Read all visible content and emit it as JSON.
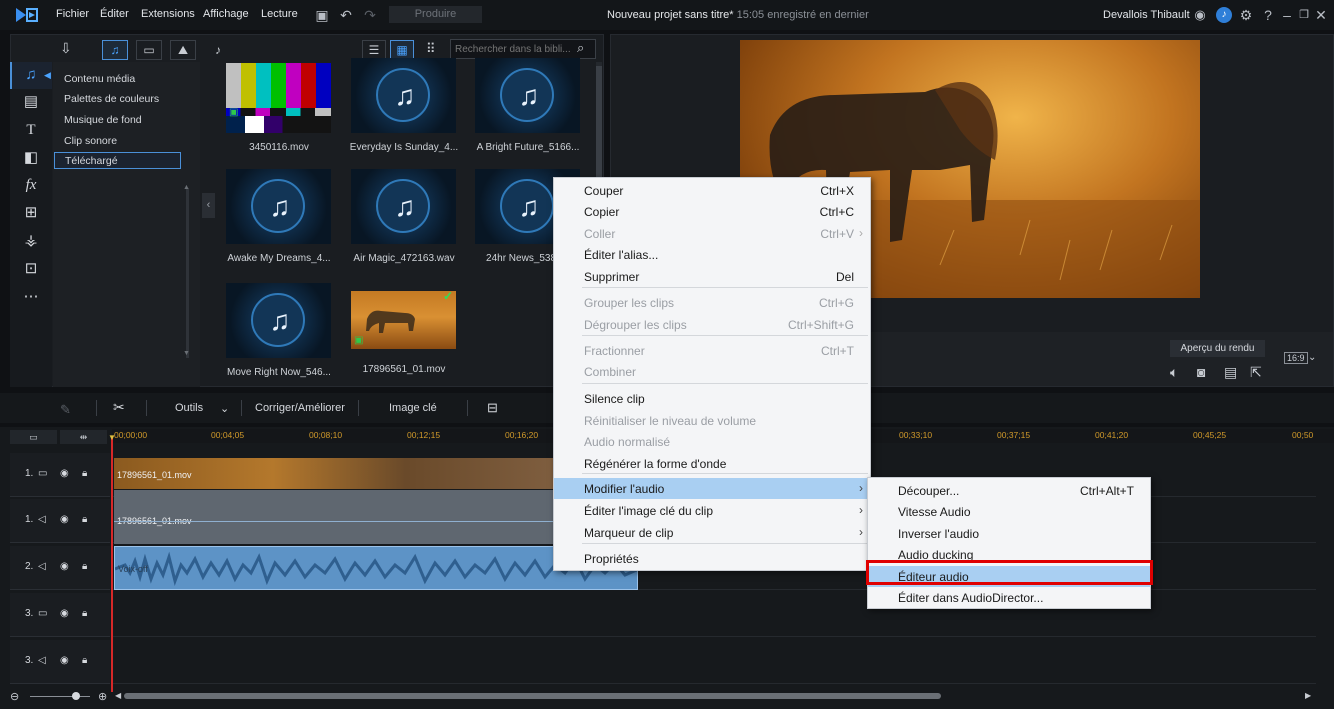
{
  "menubar": {
    "items": [
      "Fichier",
      "Éditer",
      "Extensions",
      "Affichage",
      "Lecture"
    ],
    "produce_label": "Produire",
    "project_title": "Nouveau projet sans titre*",
    "project_saved": "15:05 enregistré en dernier",
    "user_name": "Devallois Thibault"
  },
  "library": {
    "search_placeholder": "Rechercher dans la bibli...",
    "categories": [
      "Contenu média",
      "Palettes de couleurs",
      "Musique de fond",
      "Clip sonore",
      "Téléchargé"
    ],
    "selected_category": "Téléchargé",
    "media": [
      {
        "name": "3450116.mov",
        "kind": "colorbars"
      },
      {
        "name": "Everyday Is Sunday_4...",
        "kind": "music"
      },
      {
        "name": "A Bright Future_5166...",
        "kind": "music"
      },
      {
        "name": "Awake My Dreams_4...",
        "kind": "music"
      },
      {
        "name": "Air Magic_472163.wav",
        "kind": "music"
      },
      {
        "name": "24hr News_5388...",
        "kind": "music"
      },
      {
        "name": "Move Right Now_546...",
        "kind": "music"
      },
      {
        "name": "17896561_01.mov",
        "kind": "video"
      }
    ]
  },
  "preview": {
    "render_label": "Aperçu du rendu",
    "aspect": "16:9"
  },
  "edit_toolbar": {
    "tools_label": "Outils",
    "fix_label": "Corriger/Améliorer",
    "keyframe_label": "Image clé"
  },
  "timeline": {
    "timecodes": [
      "00;00;00",
      "00;04;05",
      "00;08;10",
      "00;12;15",
      "00;16;20",
      "00;33;10",
      "00;37;15",
      "00;41;20",
      "00;45;25",
      "00;50"
    ],
    "tracks": [
      {
        "label": "1.",
        "type": "video"
      },
      {
        "label": "1.",
        "type": "audio"
      },
      {
        "label": "2.",
        "type": "audio"
      },
      {
        "label": "3.",
        "type": "video"
      },
      {
        "label": "3.",
        "type": "audio"
      }
    ],
    "clip_video_label": "17896561_01.mov",
    "clip_audio_label": "17896561_01.mov",
    "clip_voice_label": "Voix-off"
  },
  "context_menu": {
    "items": [
      {
        "label": "Couper",
        "shortcut": "Ctrl+X",
        "disabled": false
      },
      {
        "label": "Copier",
        "shortcut": "Ctrl+C",
        "disabled": false
      },
      {
        "label": "Coller",
        "shortcut": "Ctrl+V",
        "disabled": true
      },
      {
        "label": "Éditer l'alias...",
        "shortcut": "",
        "disabled": false
      },
      {
        "label": "Supprimer",
        "shortcut": "Del",
        "disabled": false
      },
      {
        "label": "Grouper les clips",
        "shortcut": "Ctrl+G",
        "disabled": true
      },
      {
        "label": "Dégrouper les clips",
        "shortcut": "Ctrl+Shift+G",
        "disabled": true
      },
      {
        "label": "Fractionner",
        "shortcut": "Ctrl+T",
        "disabled": true
      },
      {
        "label": "Combiner",
        "shortcut": "",
        "disabled": true
      },
      {
        "label": "Silence clip",
        "shortcut": "",
        "disabled": false
      },
      {
        "label": "Réinitialiser le niveau de volume",
        "shortcut": "",
        "disabled": true
      },
      {
        "label": "Audio normalisé",
        "shortcut": "",
        "disabled": true
      },
      {
        "label": "Régénérer la forme d'onde",
        "shortcut": "",
        "disabled": false
      },
      {
        "label": "Modifier l'audio",
        "shortcut": "",
        "disabled": false
      },
      {
        "label": "Éditer l'image clé du clip",
        "shortcut": "",
        "disabled": false
      },
      {
        "label": "Marqueur de clip",
        "shortcut": "",
        "disabled": false
      },
      {
        "label": "Propriétés",
        "shortcut": "",
        "disabled": false
      }
    ],
    "highlighted": "Modifier l'audio"
  },
  "submenu": {
    "items": [
      {
        "label": "Découper...",
        "shortcut": "Ctrl+Alt+T"
      },
      {
        "label": "Vitesse Audio",
        "shortcut": ""
      },
      {
        "label": "Inverser l'audio",
        "shortcut": ""
      },
      {
        "label": "Audio ducking",
        "shortcut": ""
      },
      {
        "label": "Éditeur audio",
        "shortcut": ""
      },
      {
        "label": "Éditer dans AudioDirector...",
        "shortcut": ""
      }
    ],
    "highlighted": "Éditeur audio"
  },
  "colors": {
    "accent": "#4a90d9",
    "highlight": "#a9cff2",
    "annotation_red": "#e00000",
    "timecode": "#d19a2a"
  }
}
